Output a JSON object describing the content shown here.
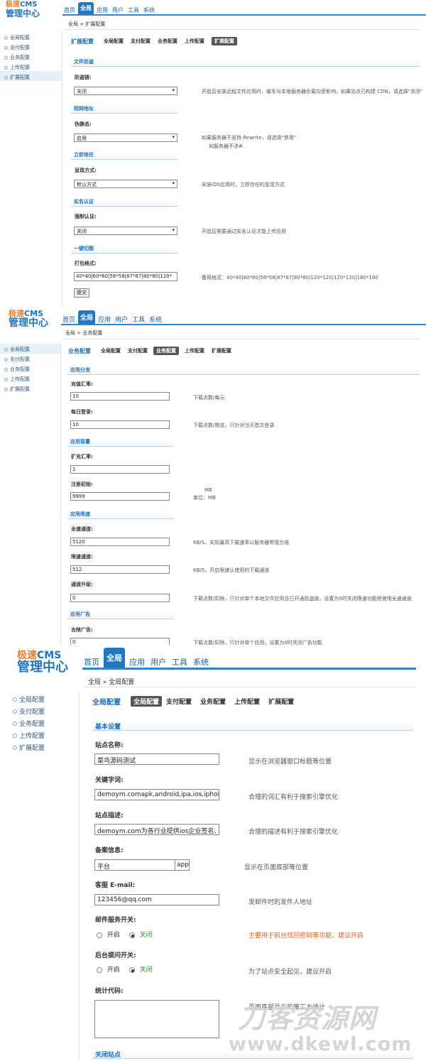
{
  "logo": {
    "line1_a": "极速",
    "line1_b": "CMS",
    "line2": "管理中心"
  },
  "nav": [
    "首页",
    "全局",
    "应用",
    "用户",
    "工具",
    "系统"
  ],
  "sidebar": [
    "全局配置",
    "支付配置",
    "业务配置",
    "上传配置",
    "扩展配置"
  ],
  "tabs": [
    "全局配置",
    "支付配置",
    "业务配置",
    "上传配置",
    "扩展配置"
  ],
  "p1": {
    "crumb": "全局 > 扩展配置",
    "title": "扩展配置",
    "sec1": "文件防盗",
    "lab1": "防盗链:",
    "val1": "关闭",
    "hint1": "开启后安装远程文件应用时，缓军与本地服务器负载均受影响，如果站点已构建 CDN，请选择\"关闭\"",
    "sec2": "短网地址",
    "lab2": "伪静态:",
    "val2": "启用",
    "hint2a": "如果服务器不支持 Rewrite，请选择\"禁用\"",
    "hint2b": "如服务器不涉#.",
    "sec3": "立即信任",
    "lab3": "呈现方式:",
    "val3": "默认方式",
    "hint3": "安装iOS应用时，立即信任的呈现方式",
    "sec4": "实名认证",
    "lab4": "强制认证:",
    "val4": "关闭",
    "hint4": "开启后需要通过实名认证才能上传应用",
    "sec5": "一键切图",
    "lab5": "打包格式:",
    "val5": "40*40|60*60|58*58|87*87|80*80|120*",
    "hint5": "备用格式：40*40|60*60|58*58|87*87|80*80|120*120|120*120|180*180",
    "submit": "提交"
  },
  "p2": {
    "crumb": "全局 > 业务配置",
    "title": "业务配置",
    "sec1": "应用分发",
    "lab1": "充值汇率:",
    "val1": "10",
    "hint1": "下载点数/每元",
    "lab2": "每日登录:",
    "val2": "10",
    "hint2": "下载点数/赠送，只针对当天首次登录",
    "sec2": "应用容量",
    "lab3": "扩充汇率:",
    "val3": "1",
    "lab4": "注册初始:",
    "val4": "9999",
    "hint4a": "MB",
    "hint4b": "单位：MB",
    "sec3": "应用限速",
    "lab5": "全速通道:",
    "val5": "5120",
    "hint5": "KB/S，实际最高下载速率以服务器带宽为准",
    "lab6": "限速通道:",
    "val6": "512",
    "hint6": "KB/S，开启限速认使用的下载通道",
    "lab7": "通道升级:",
    "val7": "0",
    "hint7": "下载点数/扣除，只针对单个本地文件应用且已开通防盗链，设置为0时关闭限速功能将使用全速通道",
    "sec4": "应用广告",
    "lab8": "去除广告:",
    "val8": "0",
    "hint8": "下载点数/扣除，只针对单个应用，设置为0时关闭广告功能"
  },
  "p3": {
    "crumb": "全局 » 全局配置",
    "title": "全局配置",
    "sec1": "基本设置",
    "lab1": "站点名称:",
    "val1": "菜鸟源码测试",
    "hint1": "显示在浏览器窗口标题等位置",
    "lab2": "关键字词:",
    "val2": "demoym.comapk,android,ipa,ios,iphone,i",
    "hint2": "合理的词汇有利于搜索引擎优化",
    "lab3": "站点描述:",
    "val3": "demoym.com为各行业提供ios企业签名、app",
    "hint3": "合理的描述有利于搜索引擎优化",
    "lab4": "备案信息:",
    "val4": "平台",
    "val4b": "app",
    "hint4": "显示在页面底部等位置",
    "lab5": "客服 E-mail:",
    "val5": "123456@qq.com",
    "hint5": "发邮件时的发件人地址",
    "lab6": "邮件服务开关:",
    "opt_on": "开启",
    "opt_off": "关闭",
    "hint6": "主要用于前台找回密码等功能，建议开启",
    "lab7": "后台提问开关:",
    "hint7": "为了站点安全起见，建议开启",
    "lab8": "统计代码:",
    "hint8": "页面底部显示的第三方统计",
    "sec2": "关闭站点"
  },
  "watermark": {
    "line1": "刀客资源网",
    "line2": "www.dkewl.com"
  }
}
